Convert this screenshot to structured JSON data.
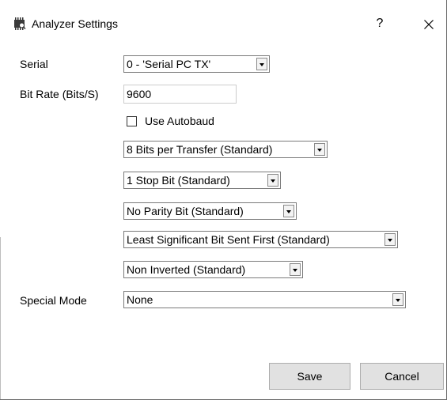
{
  "window": {
    "title": "Analyzer Settings",
    "help_glyph": "?",
    "close_glyph": "✕",
    "icon": "analyzer-chip-icon"
  },
  "form": {
    "serial_label": "Serial",
    "serial_value": "0 - 'Serial PC TX'",
    "bitrate_label": "Bit Rate (Bits/S)",
    "bitrate_value": "9600",
    "autobaud_label": "Use Autobaud",
    "autobaud_checked": false,
    "bits_per_transfer": "8 Bits per Transfer (Standard)",
    "stop_bits": "1 Stop Bit (Standard)",
    "parity": "No Parity Bit (Standard)",
    "bit_order": "Least Significant Bit Sent First (Standard)",
    "inversion": "Non Inverted (Standard)",
    "special_mode_label": "Special Mode",
    "special_mode_value": "None"
  },
  "buttons": {
    "save_label": "Save",
    "cancel_label": "Cancel"
  }
}
